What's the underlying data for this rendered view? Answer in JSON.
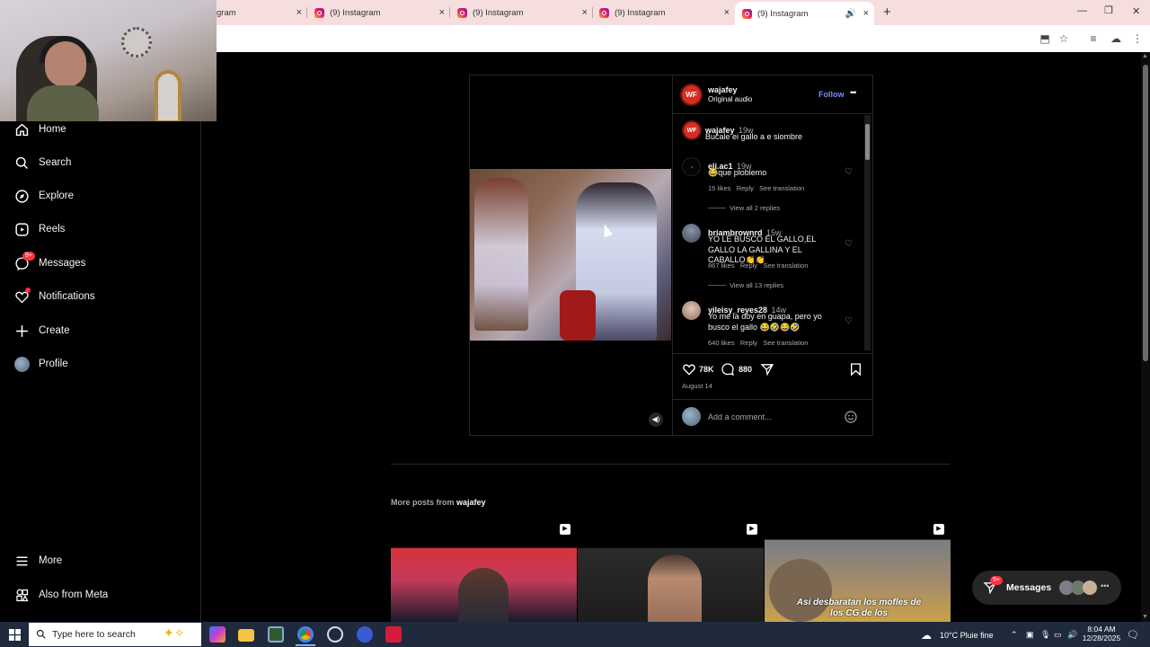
{
  "browser": {
    "tabs": [
      {
        "title": "gram"
      },
      {
        "title": "(9) Instagram"
      },
      {
        "title": "(9) Instagram"
      },
      {
        "title": "(9) Instagram"
      },
      {
        "title": "(9) Instagram"
      }
    ],
    "active_tab_index": 4,
    "new_tab_glyph": "+",
    "close_glyph": "×"
  },
  "sidebar": {
    "items": [
      {
        "label": "Home",
        "icon": "home-icon"
      },
      {
        "label": "Search",
        "icon": "search-icon"
      },
      {
        "label": "Explore",
        "icon": "compass-icon"
      },
      {
        "label": "Reels",
        "icon": "reels-icon"
      },
      {
        "label": "Messages",
        "icon": "messenger-icon",
        "badge": "9+"
      },
      {
        "label": "Notifications",
        "icon": "heart-icon"
      },
      {
        "label": "Create",
        "icon": "plus-icon"
      },
      {
        "label": "Profile",
        "icon": "avatar"
      }
    ],
    "bottom": [
      {
        "label": "More",
        "icon": "menu-icon"
      },
      {
        "label": "Also from Meta",
        "icon": "meta-icon"
      }
    ]
  },
  "post": {
    "author": "wajafey",
    "avatar_text": "WF",
    "audio": "Original audio",
    "follow_label": "Follow",
    "more_glyph": "•••",
    "caption": {
      "user": "wajafey",
      "time": "19w",
      "text": "Bucale ei gallo a e siombre"
    },
    "comments": [
      {
        "user": "eli.ac1",
        "time": "19w",
        "text": "😂que ploblemo",
        "likes": "15 likes",
        "reply": "Reply",
        "translate": "See translation",
        "view_replies": "View all 2 replies"
      },
      {
        "user": "briambrownrd",
        "time": "15w",
        "text": "YO LE BUSCO EL GALLO,EL GALLO LA GALLINA Y EL CABALLO👏👏",
        "likes": "867 likes",
        "reply": "Reply",
        "translate": "See translation",
        "view_replies": "View all 13 replies"
      },
      {
        "user": "yileisy_reyes28",
        "time": "14w",
        "text": "Yo me la doy en guapa, pero yo busco el gallo 😂🤣😂🤣",
        "likes": "640 likes",
        "reply": "Reply",
        "translate": "See translation"
      }
    ],
    "likes_count": "78K",
    "comments_count": "880",
    "date": "August 14",
    "add_comment_placeholder": "Add a comment..."
  },
  "more_posts": {
    "prefix": "More posts from ",
    "user": "wajafey",
    "thumb3_caption": "Asi desbaratan los mofles de los CG de los"
  },
  "messages_pill": {
    "label": "Messages",
    "badge": "9+"
  },
  "taskbar": {
    "search_placeholder": "Type here to search",
    "weather": "10°C  Pluie fine",
    "time": "8:04 AM",
    "date": "12/28/2025"
  }
}
